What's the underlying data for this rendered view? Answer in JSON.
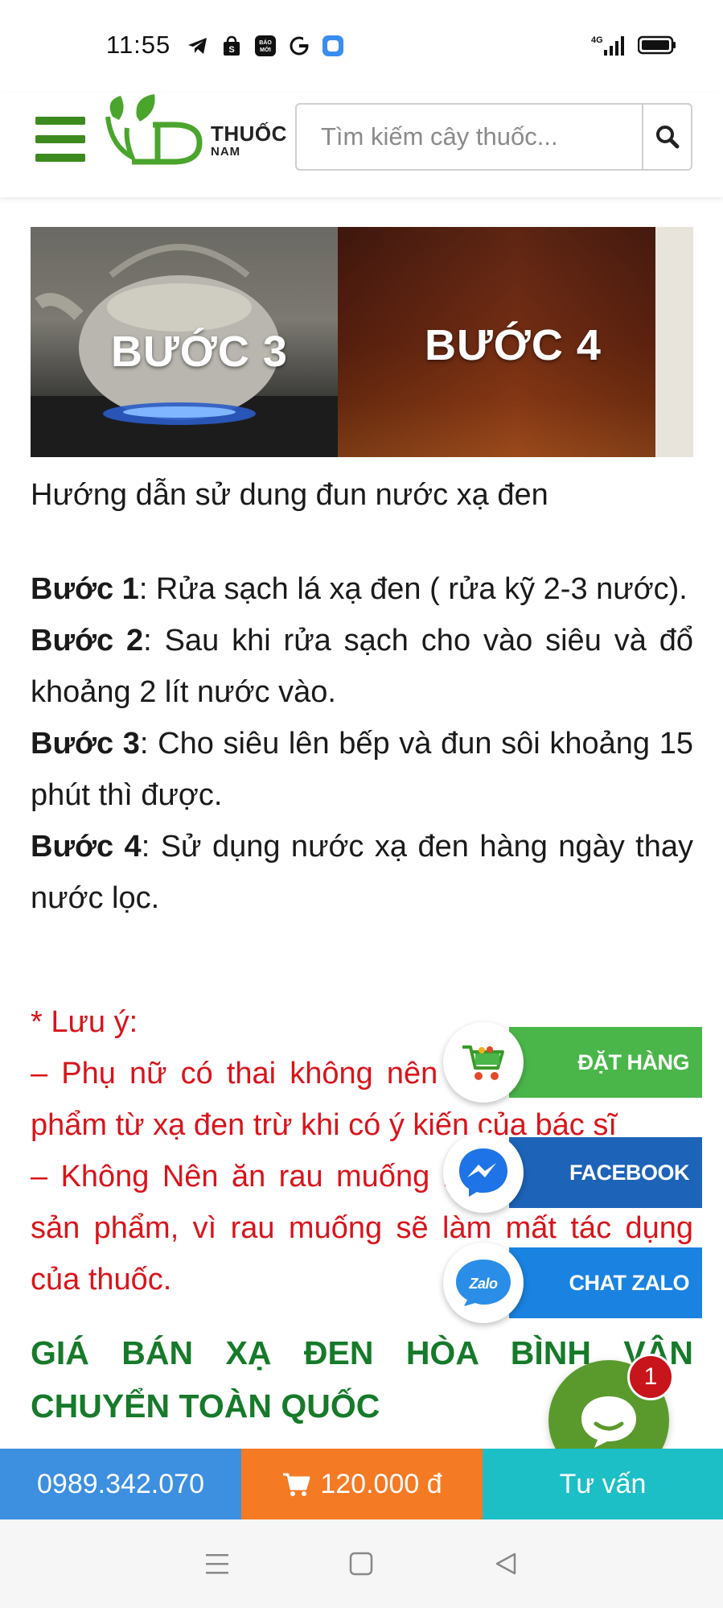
{
  "status_bar": {
    "time": "11:55",
    "app_icons": [
      "telegram-icon",
      "shopee-icon",
      "baomoi-icon",
      "google-icon",
      "app-square-icon"
    ],
    "network": "4G",
    "battery": "battery-icon"
  },
  "header": {
    "menu_icon": "hamburger-icon",
    "logo_line1": "THUỐC",
    "logo_line2": "NAM",
    "search_placeholder": "Tìm kiếm cây thuốc...",
    "search_icon": "search-icon",
    "brand_color": "#3d8a1e"
  },
  "hero": {
    "left_label": "BƯỚC 3",
    "right_label": "BƯỚC 4"
  },
  "article": {
    "caption": "Hướng dẫn sử dung đun nước xạ đen",
    "steps": [
      {
        "label": "Bước 1",
        "text": ": Rửa sạch lá xạ đen ( rửa kỹ 2-3 nước)."
      },
      {
        "label": "Bước 2",
        "text": ": Sau khi rửa sạch cho vào siêu và đổ khoảng 2 lít nước vào."
      },
      {
        "label": "Bước 3",
        "text": ": Cho siêu lên bếp và đun sôi khoảng 15 phút thì được."
      },
      {
        "label": "Bước 4",
        "text": ": Sử dụng nước xạ đen hàng ngày thay nước lọc."
      }
    ],
    "note_title": "* Lưu ý:",
    "note_lines": [
      "– Phụ nữ có thai không nên sử dụng các sản phẩm từ xạ đen trừ khi có ý kiến của bác sĩ",
      "– Không Nên ăn rau muống khi đang sử dụng sản phẩm, vì rau muống sẽ làm mất tác dụng của thuốc."
    ],
    "note_color": "#d9141b",
    "price_heading": "GIÁ BÁN XẠ ĐEN HÒA BÌNH VẬN CHUYỂN TOÀN QUỐC",
    "heading_color": "#167a2a"
  },
  "floating": {
    "order_label": "ĐẶT HÀNG",
    "facebook_label": "FACEBOOK",
    "zalo_label": "CHAT ZALO",
    "zalo_icon_text": "Zalo",
    "chat_badge_count": "1"
  },
  "bottom_bar": {
    "phone": "0989.342.070",
    "price": "120.000 đ",
    "consult": "Tư vấn"
  },
  "nav": {
    "menu": "recent-apps-icon",
    "home": "home-icon",
    "back": "back-icon"
  }
}
